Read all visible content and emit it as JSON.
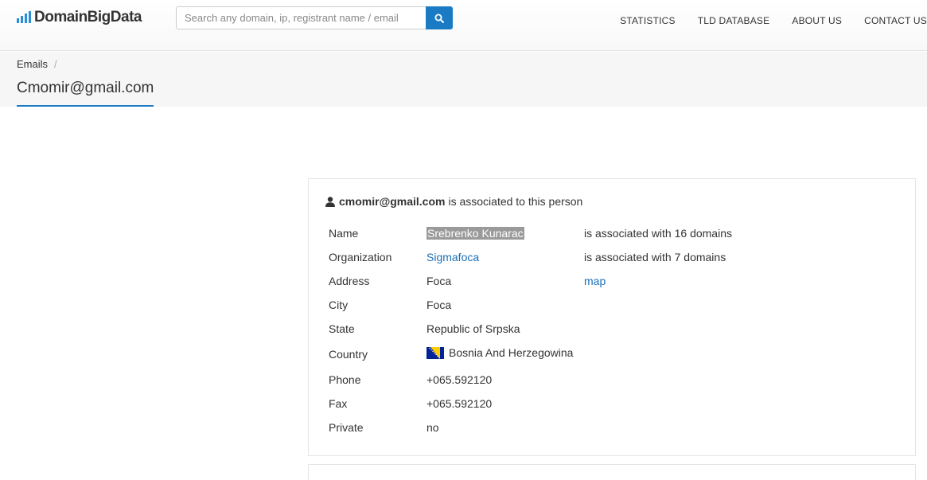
{
  "header": {
    "logo_text": "DomainBigData",
    "search_placeholder": "Search any domain, ip, registrant name / email",
    "nav": [
      "STATISTICS",
      "TLD DATABASE",
      "ABOUT US",
      "CONTACT US"
    ]
  },
  "breadcrumb": {
    "item": "Emails",
    "separator": "/"
  },
  "page_title": "Cmomir@gmail.com",
  "card": {
    "email": "cmomir@gmail.com",
    "title_suffix": "is associated to this person",
    "rows": [
      {
        "label": "Name",
        "value": "Srebrenko Kunarac",
        "extra": "is associated with 16 domains"
      },
      {
        "label": "Organization",
        "value": "Sigmafoca",
        "extra": "is associated with 7 domains"
      },
      {
        "label": "Address",
        "value": "Foca",
        "extra": "map"
      },
      {
        "label": "City",
        "value": "Foca"
      },
      {
        "label": "State",
        "value": "Republic of Srpska"
      },
      {
        "label": "Country",
        "value": "Bosnia And Herzegowina"
      },
      {
        "label": "Phone",
        "value": "+065.592120"
      },
      {
        "label": "Fax",
        "value": "+065.592120"
      },
      {
        "label": "Private",
        "value": "no"
      }
    ]
  },
  "colors": {
    "accent": "#1a7bc4",
    "link": "#1a6fb8",
    "highlight": "#9a9a9a"
  },
  "icons": {
    "search": "search-icon",
    "person": "user-icon",
    "flag": "bosnia-flag-icon"
  }
}
